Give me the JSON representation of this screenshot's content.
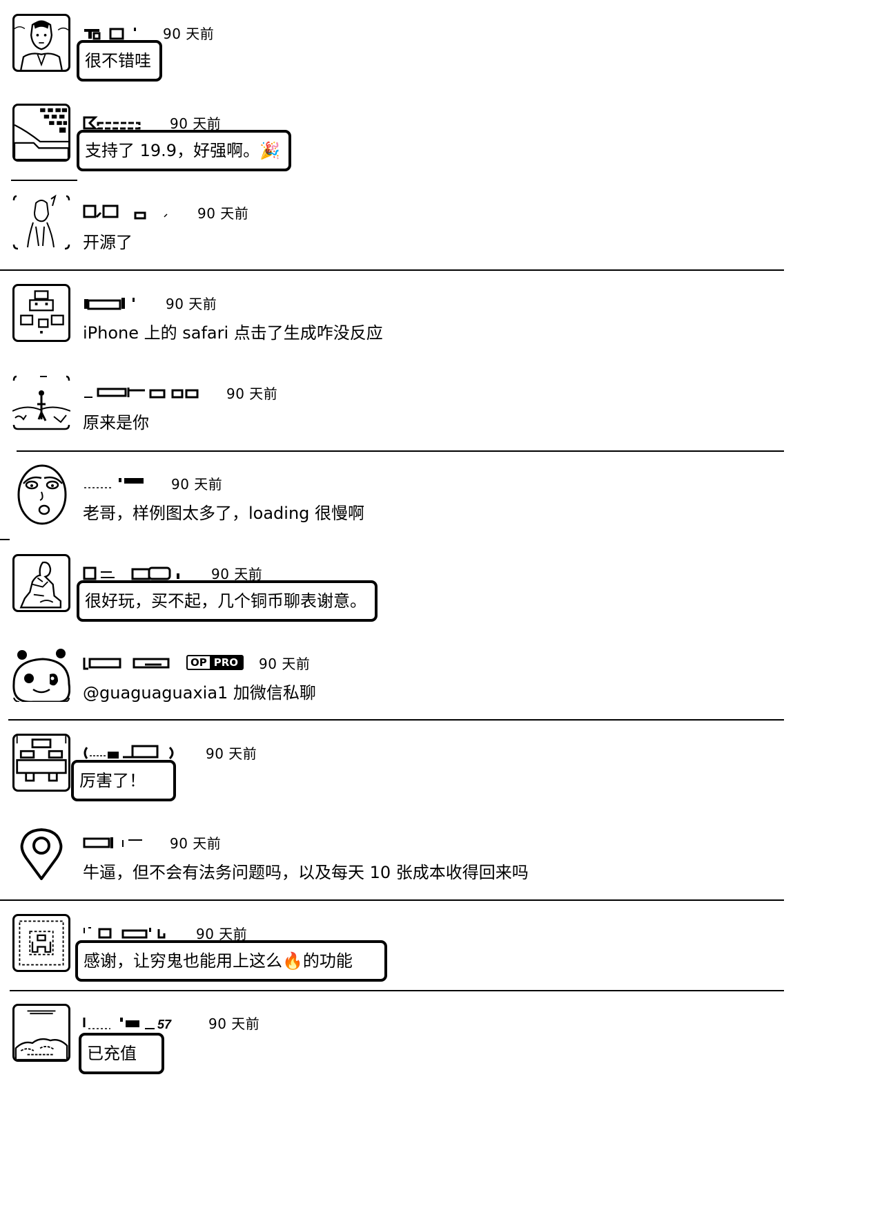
{
  "comments": [
    {
      "avatar": "avatar-man-in-suit",
      "time": "90 天前",
      "text": "很不错哇",
      "boxed": true
    },
    {
      "avatar": "avatar-pattern-folder",
      "time": "90 天前",
      "text": "支持了 19.9，好强啊。🎉",
      "boxed": true
    },
    {
      "avatar": "avatar-drawing-figure",
      "time": "90 天前",
      "text": "开源了",
      "boxed": false
    },
    {
      "avatar": "avatar-pixel-robot",
      "time": "90 天前",
      "text": "iPhone 上的 safari 点击了生成咋没反应",
      "boxed": false
    },
    {
      "avatar": "avatar-landscape-person",
      "time": "90 天前",
      "text": "原来是你",
      "boxed": false
    },
    {
      "avatar": "avatar-cartoon-face",
      "time": "90 天前",
      "text": "老哥，样例图太多了，loading 很慢啊",
      "boxed": false
    },
    {
      "avatar": "avatar-statue",
      "time": "90 天前",
      "text": "很好玩，买不起，几个铜币聊表谢意。",
      "boxed": true
    },
    {
      "avatar": "avatar-panda",
      "time": "90 天前",
      "badge": {
        "left": "OP",
        "right": "PRO"
      },
      "text": "@guaguaguaxia1 加微信私聊",
      "boxed": false
    },
    {
      "avatar": "avatar-pixel-invader",
      "time": "90 天前",
      "text": "厉害了！",
      "boxed": true
    },
    {
      "avatar": "location-pin-icon",
      "time": "90 天前",
      "text": "牛逼，但不会有法务问题吗，以及每天 10 张成本收得回来吗",
      "boxed": false
    },
    {
      "avatar": "avatar-pixel-grid",
      "time": "90 天前",
      "text": "感谢，让穷鬼也能用上这么🔥的功能",
      "boxed": true
    },
    {
      "avatar": "avatar-sand-landscape",
      "time": "90 天前",
      "text": "已充值",
      "boxed": true
    }
  ]
}
